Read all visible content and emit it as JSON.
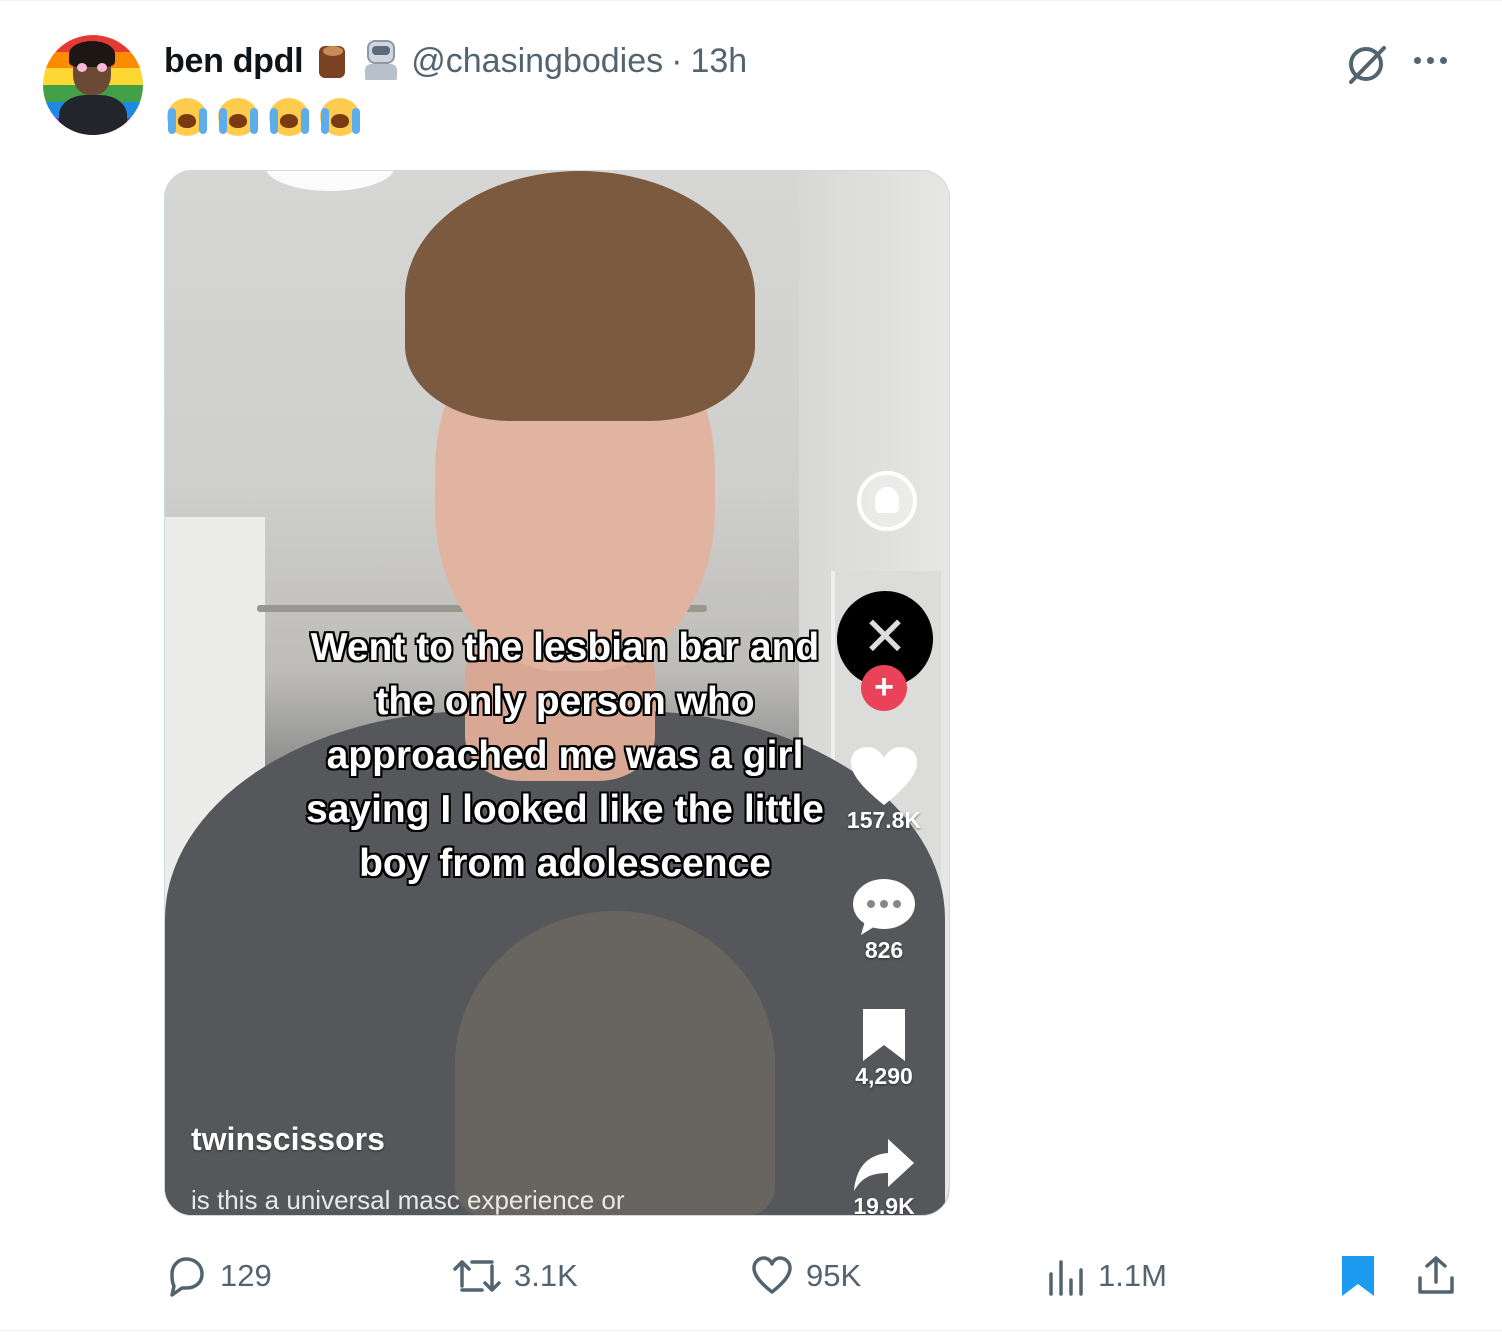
{
  "tweet": {
    "display_name": "ben dpdl",
    "handle": "@chasingbodies",
    "separator": "·",
    "time": "13h",
    "name_emojis": [
      "log-emoji",
      "robot-emoji"
    ],
    "body_emojis": [
      "loudly-crying-face",
      "loudly-crying-face",
      "loudly-crying-face",
      "loudly-crying-face"
    ]
  },
  "media": {
    "overlay_lines": [
      "Went to the lesbian bar and",
      "the only person who",
      "approached me was a girl",
      "saying I looked like the little",
      "boy from adolescence"
    ],
    "username": "twinscissors",
    "caption": "is this a universal masc experience or",
    "likes": "157.8K",
    "comments": "826",
    "saves": "4,290",
    "shares": "19.9K",
    "follow_symbol": "+"
  },
  "actions": {
    "replies": "129",
    "reposts": "3.1K",
    "likes": "95K",
    "views": "1.1M"
  },
  "colors": {
    "secondary_text": "#536471",
    "bookmark_active": "#1d9bf0",
    "tiktok_follow": "#ea4359"
  }
}
